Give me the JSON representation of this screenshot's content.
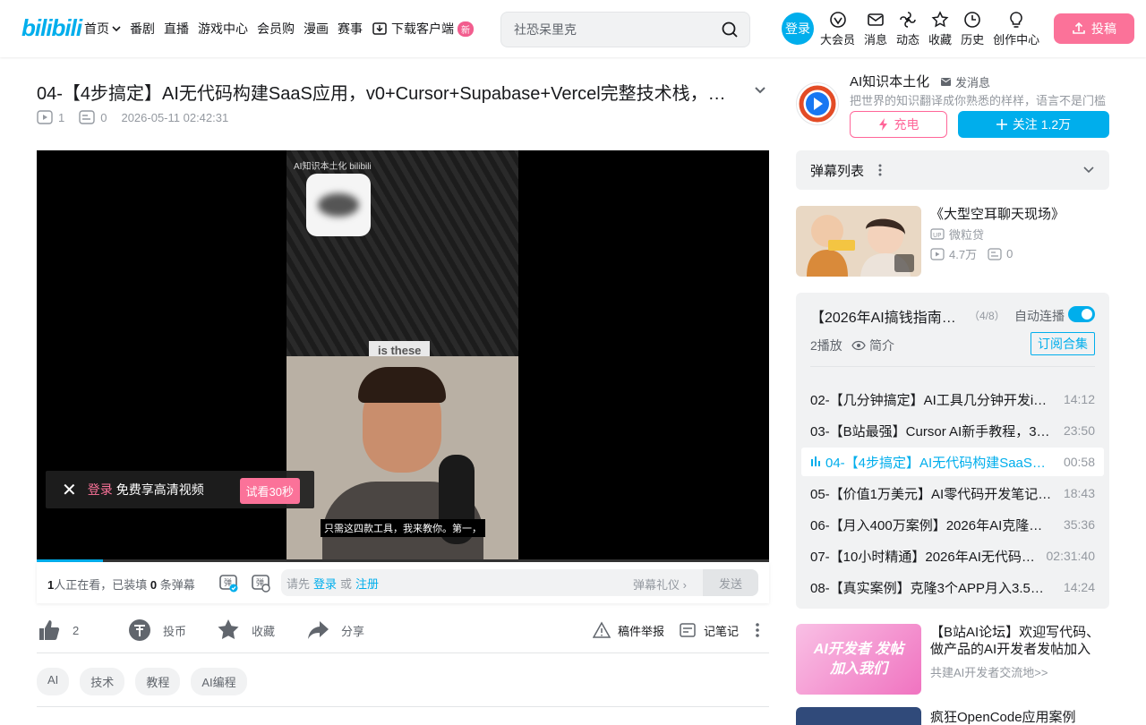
{
  "header": {
    "logo": "bilibili",
    "nav": [
      "首页",
      "番剧",
      "直播",
      "游戏中心",
      "会员购",
      "漫画",
      "赛事"
    ],
    "download": "下载客户端",
    "new_badge": "新",
    "search_placeholder": "社恐呆里克",
    "login": "登录",
    "entries": [
      "大会员",
      "消息",
      "动态",
      "收藏",
      "历史",
      "创作中心"
    ],
    "upload": "投稿"
  },
  "video": {
    "title": "04-【4步搞定】AI无代码构建SaaS应用，v0+Cursor+Supabase+Vercel完整技术栈，…",
    "plays": "1",
    "danmaku": "0",
    "date": "2026-05-11 02:42:31"
  },
  "player": {
    "brand": "AI知识本土化 bilibili",
    "caption_top": "is these",
    "subtitle": "只需这四款工具，我来教你。第一，",
    "login_tip_link": "登录",
    "login_tip_text": "免费享高清视频",
    "try_btn": "试看30秒",
    "progress": 0.09
  },
  "danmaku_bar": {
    "watching_count": "1",
    "watching_text": "人正在看，已装填",
    "dm_count": "0",
    "dm_text": "条弹幕",
    "prompt": "请先",
    "login": "登录",
    "or": "或",
    "register": "注册",
    "gift": "弹幕礼仪",
    "send": "发送"
  },
  "toolbar": {
    "like": "2",
    "coin": "投币",
    "fav": "收藏",
    "share": "分享",
    "report": "稿件举报",
    "note": "记笔记"
  },
  "tags": [
    "AI",
    "技术",
    "教程",
    "AI编程"
  ],
  "up": {
    "name": "AI知识本土化",
    "message": "发消息",
    "desc": "把世界的知识翻译成你熟悉的样样，语言不是门槛",
    "charge": "充电",
    "follow": "关注 1.2万"
  },
  "danmaku_list": "弹幕列表",
  "rec1": {
    "title": "《大型空耳聊天现场》",
    "up": "微粒贷",
    "plays": "4.7万",
    "comments": "0"
  },
  "collection": {
    "title": "【2026年AI搞钱指南…",
    "count": "（4/8）",
    "autoplay": "自动连播",
    "plays": "2播放",
    "intro": "简介",
    "subscribe": "订阅合集",
    "episodes": [
      {
        "title": "02-【几分钟搞定】AI工具几分钟开发i…",
        "dur": "14:12"
      },
      {
        "title": "03-【B站最强】Cursor AI新手教程，3…",
        "dur": "23:50"
      },
      {
        "title": "04-【4步搞定】AI无代码构建SaaS…",
        "dur": "00:58"
      },
      {
        "title": "05-【价值1万美元】AI零代码开发笔记…",
        "dur": "18:43"
      },
      {
        "title": "06-【月入400万案例】2026年AI克隆…",
        "dur": "35:36"
      },
      {
        "title": "07-【10小时精通】2026年AI无代码…",
        "dur": "02:31:40"
      },
      {
        "title": "08-【真实案例】克隆3个APP月入3.5…",
        "dur": "14:24"
      }
    ]
  },
  "rec2": {
    "title": "【B站AI论坛】欢迎写代码、做产品的AI开发者发帖加入",
    "sub": "共建AI开发者交流地>>",
    "thumb_text": "AI开发者 发帖加入我们"
  },
  "rec3": {
    "title": "疯狂OpenCode应用案例"
  },
  "colors": {
    "brand_blue": "#00aeec",
    "brand_pink": "#fb7299"
  }
}
